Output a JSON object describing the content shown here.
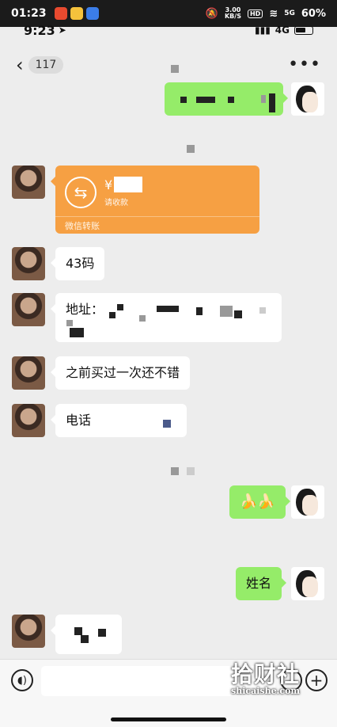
{
  "outer_status": {
    "time": "01:23",
    "net_speed": "3.00",
    "net_unit": "KB/S",
    "hd": "HD",
    "signal": "5G",
    "battery": "60%"
  },
  "inner_status": {
    "time": "9:23",
    "network": "4G"
  },
  "nav": {
    "unread_count": "117",
    "more_label": "•••"
  },
  "messages": {
    "transfer": {
      "currency": "¥",
      "status": "请收款",
      "footer": "微信转账"
    },
    "size": "43码",
    "address_label": "地址：",
    "review": "之前买过一次还不错",
    "phone_label": "电话",
    "emoji": "🍌🍌",
    "name": "姓名"
  },
  "input": {
    "placeholder": ""
  },
  "watermark": {
    "cn": "拾财社",
    "en": "shicaishe.com"
  },
  "colors": {
    "accent_green": "#95ec69",
    "transfer_orange": "#f6a043",
    "background": "#ededed"
  }
}
